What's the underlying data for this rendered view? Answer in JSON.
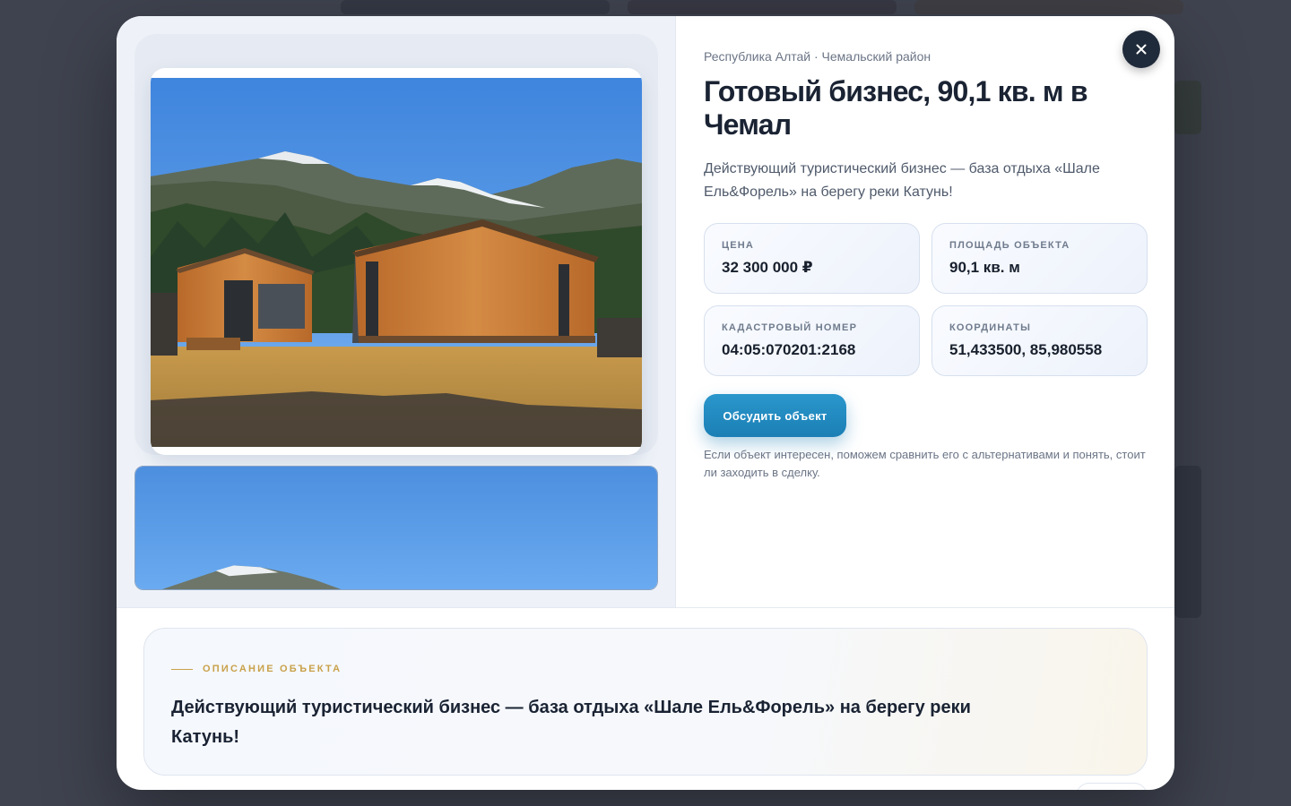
{
  "listing": {
    "region": "Республика Алтай · Чемальский район",
    "title": "Готовый бизнес, 90,1 кв. м в Чемал",
    "subtitle": "Действующий туристический бизнес — база отдыха «Шале Ель&Форель» на берегу реки Катунь!",
    "stats": [
      {
        "label": "Цена",
        "value": "32 300 000 ₽"
      },
      {
        "label": "Площадь объекта",
        "value": "90,1 кв. м"
      },
      {
        "label": "Кадастровый номер",
        "value": "04:05:070201:2168"
      },
      {
        "label": "Координаты",
        "value": "51,433500, 85,980558"
      }
    ],
    "cta_label": "Обсудить объект",
    "hint": "Если объект интересен, поможем сравнить его с альтернативами и понять, стоит ли заходить в сделку."
  },
  "description": {
    "kicker": "ОПИСАНИЕ ОБЪЕКТА",
    "text": "Действующий туристический бизнес — база отдыха «Шале Ель&Форель» на берегу реки Катунь!"
  },
  "icons": {
    "close": "close-icon"
  },
  "colors": {
    "accent": "#1b7fb5",
    "gold": "#c9a14a",
    "heading": "#1a2333"
  }
}
